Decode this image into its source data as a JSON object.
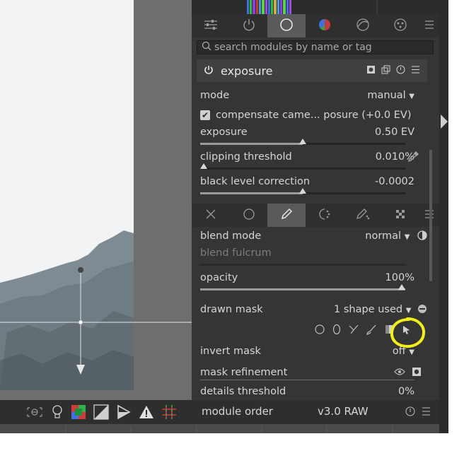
{
  "app": {
    "module_groups_tabs": [
      "sliders-icon",
      "power-icon",
      "circle-icon",
      "color-wheel-icon",
      "correct-icon",
      "effects-icon",
      "menu-icon"
    ],
    "search": {
      "placeholder": "search modules by name or tag",
      "value": ""
    },
    "module": {
      "name": "exposure",
      "mode": {
        "label": "mode",
        "value": "manual"
      },
      "compensate": {
        "label": "compensate came... posure (+0.0 EV)",
        "checked": true
      },
      "exposure": {
        "label": "exposure",
        "value": "0.50 EV",
        "level": 0.5
      },
      "clipping": {
        "label": "clipping threshold",
        "value": "0.010%",
        "level": 0.0
      },
      "black_level": {
        "label": "black level correction",
        "value": "-0.0002",
        "level": 0.5
      }
    },
    "blend": {
      "blend_mode": {
        "label": "blend mode",
        "value": "normal"
      },
      "blend_fulcrum": {
        "label": "blend fulcrum"
      },
      "opacity": {
        "label": "opacity",
        "value": "100%",
        "level": 1.0
      },
      "drawn_mask": {
        "label": "drawn mask",
        "value": "1 shape used"
      },
      "invert_mask": {
        "label": "invert mask",
        "value": "off"
      },
      "mask_refinement": {
        "label": "mask refinement"
      },
      "details_threshold": {
        "label": "details threshold",
        "value": "0%"
      }
    },
    "bottom": {
      "module_order_label": "module order",
      "module_order_value": "v3.0 RAW"
    },
    "colors": {
      "annotation": "#f2ee1b",
      "active_tab": "#5a5a5a"
    }
  }
}
